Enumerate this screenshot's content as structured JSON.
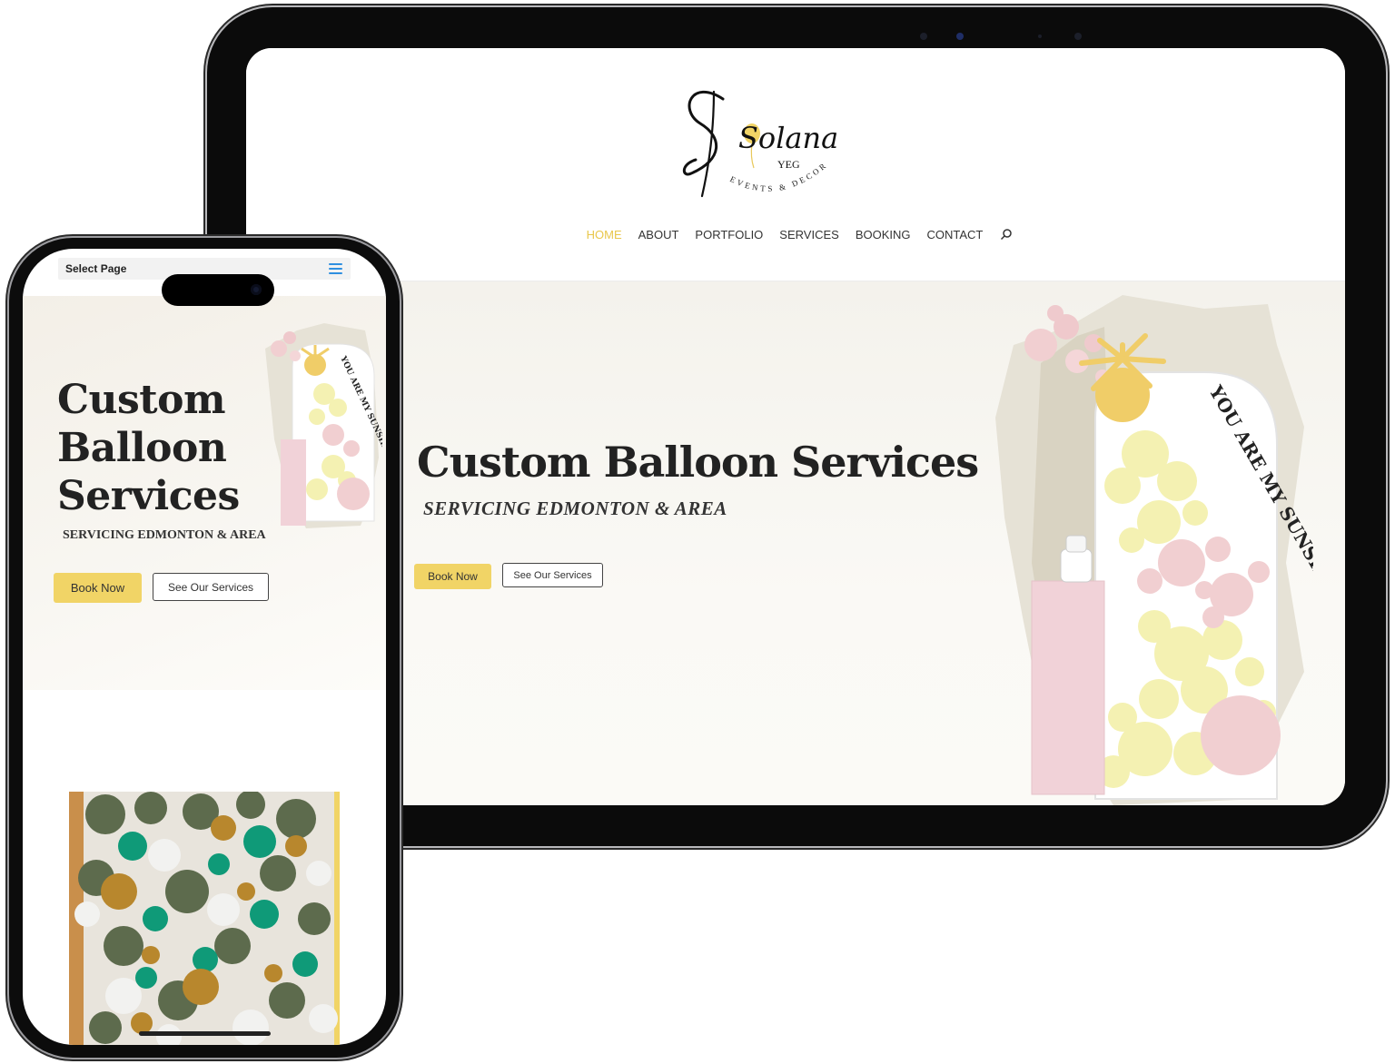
{
  "tablet": {
    "nav": {
      "items": [
        "HOME",
        "ABOUT",
        "PORTFOLIO",
        "SERVICES",
        "BOOKING",
        "CONTACT"
      ],
      "active": "HOME"
    },
    "logo": {
      "script": "Solana",
      "small": "YEG",
      "arc": "EVENTS & DECOR"
    },
    "hero": {
      "title": "Custom Balloon Services",
      "subtitle": "SERVICING EDMONTON & AREA",
      "book_button": "Book Now",
      "services_button": "See Our Services",
      "art_text": "YOU ARE MY SUNSHINE"
    }
  },
  "phone": {
    "select_label": "Select Page",
    "hero": {
      "title_lines": [
        "Custom",
        "Balloon",
        "Services"
      ],
      "subtitle": "SERVICING EDMONTON & AREA",
      "book_button": "Book Now",
      "services_button": "See Our Services",
      "art_text": "YOU ARE MY SUNSHINE"
    }
  },
  "colors": {
    "accent_yellow": "#f1d466",
    "active_nav": "#e9c74b",
    "balloon_pink": "#f1cfd1",
    "balloon_yellow": "#f4f1b2",
    "balloon_green": "#5d6b4d",
    "balloon_teal": "#0f9a78",
    "balloon_gold": "#b8872d",
    "menu_blue": "#2f8fe0"
  },
  "icons": [
    "search-icon",
    "hamburger-menu-icon",
    "sun-icon",
    "balloon-icon"
  ]
}
